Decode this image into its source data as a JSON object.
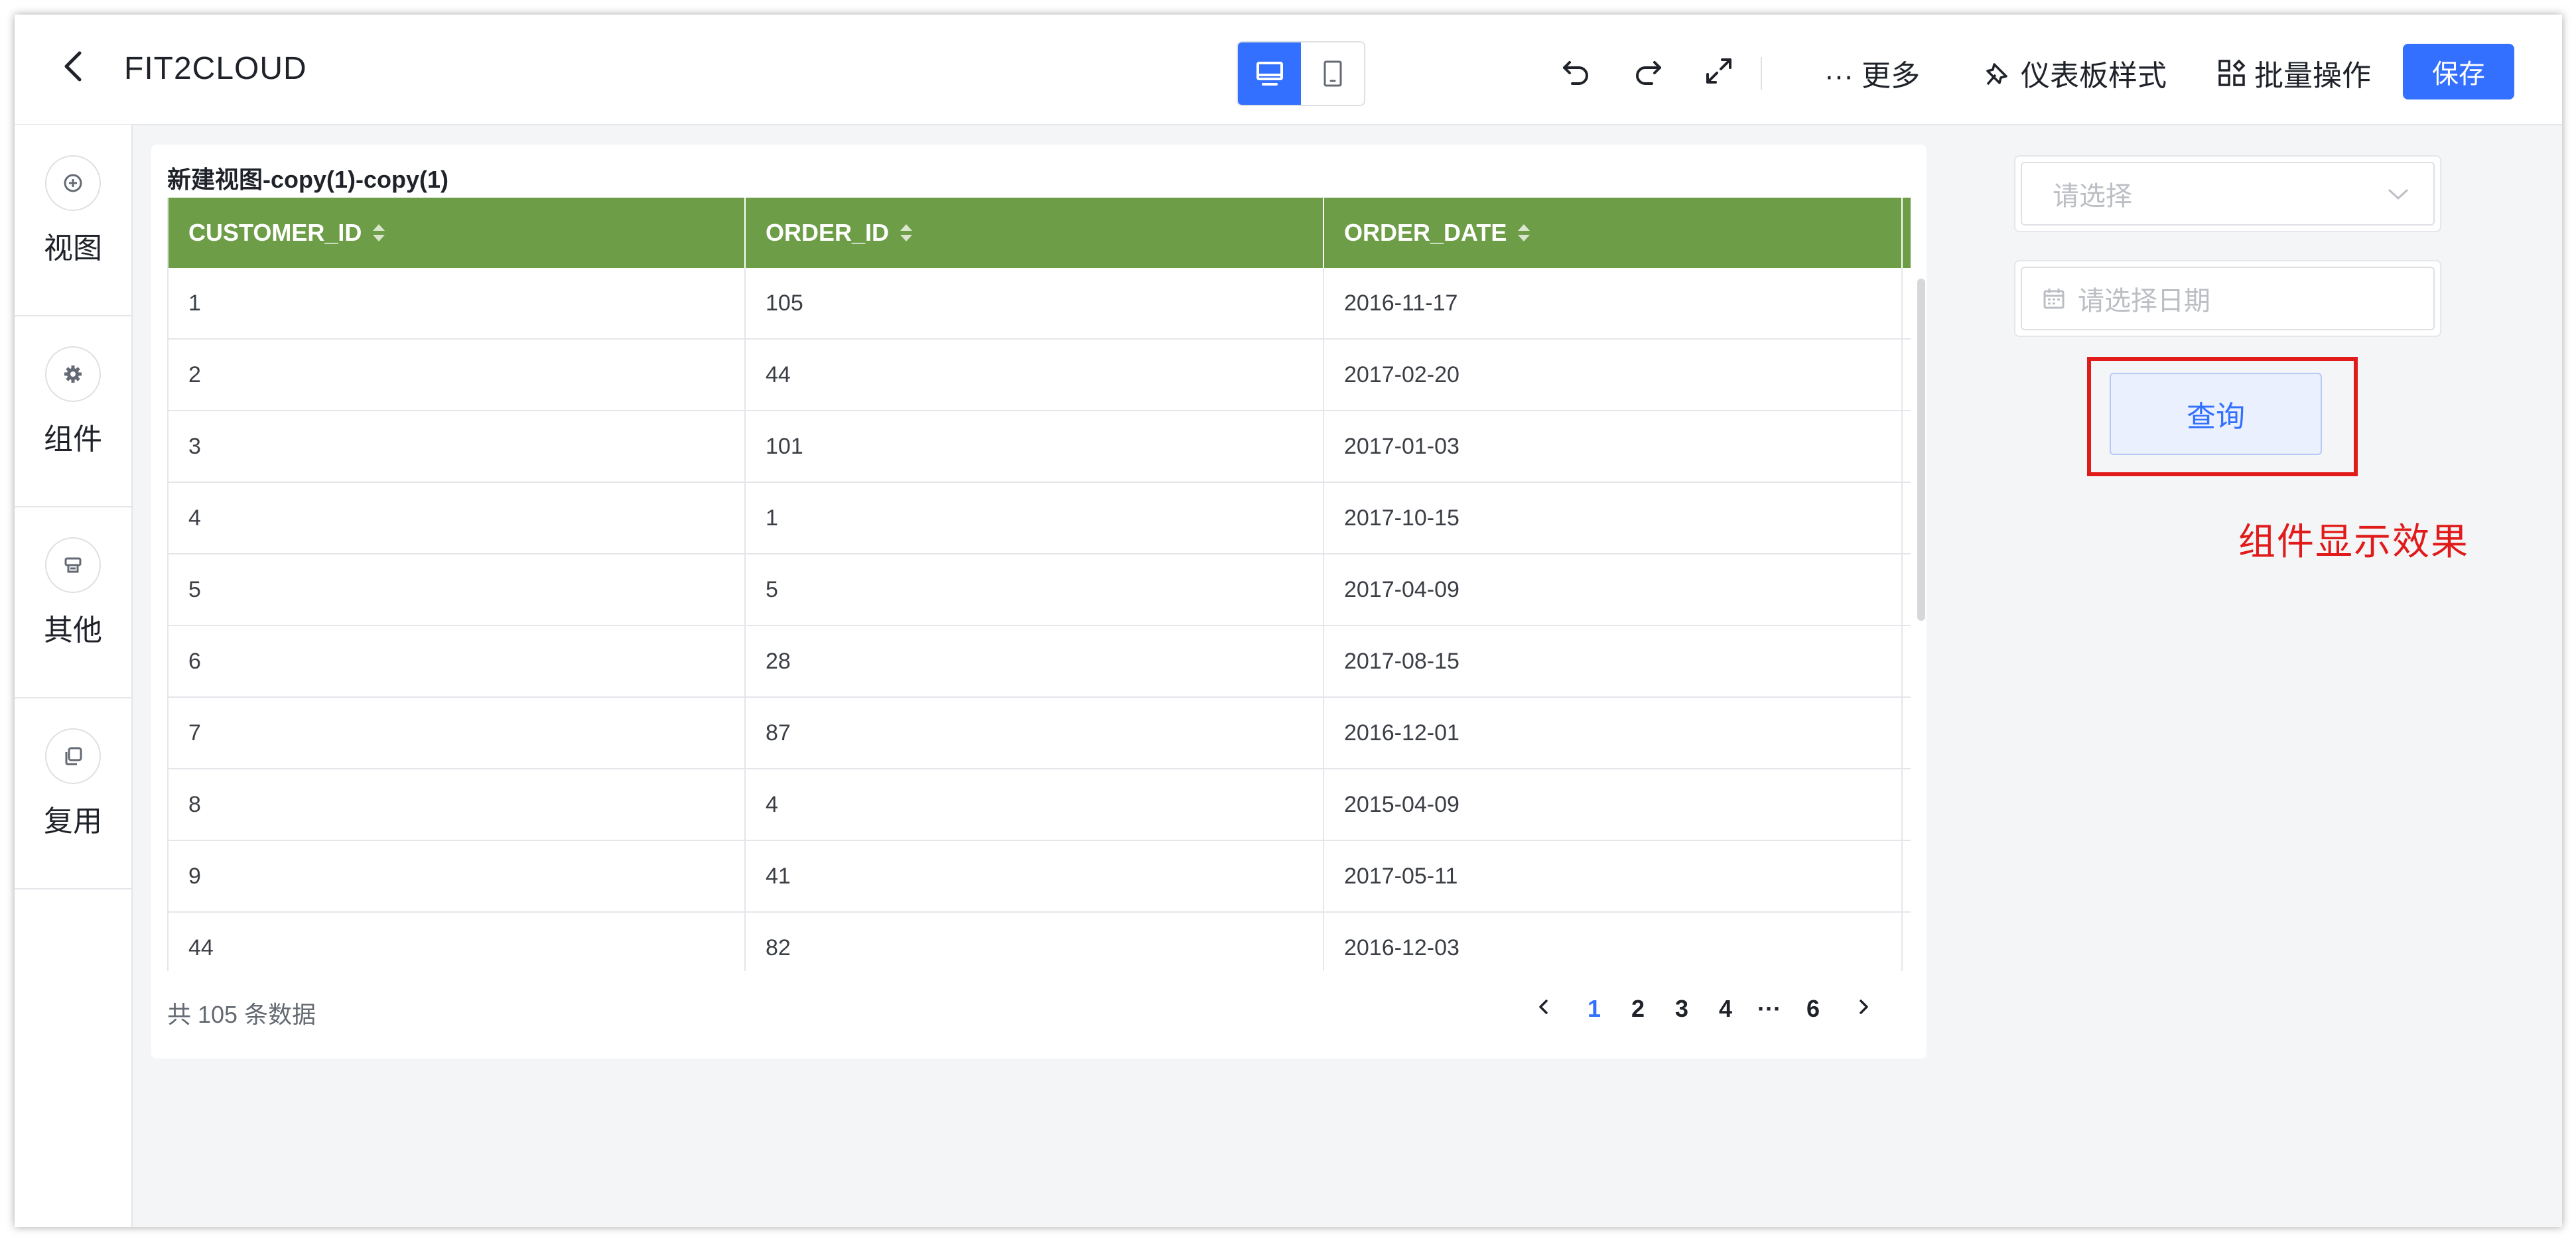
{
  "header": {
    "title": "FIT2CLOUD",
    "more_label": "··· 更多",
    "dashboard_style_label": "仪表板样式",
    "batch_label": "批量操作",
    "save_label": "保存"
  },
  "sidebar": {
    "items": [
      {
        "label": "视图",
        "icon": "plus-circle-icon"
      },
      {
        "label": "组件",
        "icon": "gear-icon"
      },
      {
        "label": "其他",
        "icon": "stamp-icon"
      },
      {
        "label": "复用",
        "icon": "copy-icon"
      }
    ]
  },
  "table": {
    "title": "新建视图-copy(1)-copy(1)",
    "header_color": "#6e9d48",
    "columns": [
      "CUSTOMER_ID",
      "ORDER_ID",
      "ORDER_DATE"
    ],
    "rows": [
      [
        "1",
        "105",
        "2016-11-17"
      ],
      [
        "2",
        "44",
        "2017-02-20"
      ],
      [
        "3",
        "101",
        "2017-01-03"
      ],
      [
        "4",
        "1",
        "2017-10-15"
      ],
      [
        "5",
        "5",
        "2017-04-09"
      ],
      [
        "6",
        "28",
        "2017-08-15"
      ],
      [
        "7",
        "87",
        "2016-12-01"
      ],
      [
        "8",
        "4",
        "2015-04-09"
      ],
      [
        "9",
        "41",
        "2017-05-11"
      ],
      [
        "44",
        "82",
        "2016-12-03"
      ]
    ],
    "total_text": "共 105 条数据",
    "pagination": {
      "pages": [
        "1",
        "2",
        "3",
        "4",
        "···",
        "6"
      ],
      "current": "1"
    }
  },
  "filters": {
    "select_placeholder": "请选择",
    "date_placeholder": "请选择日期",
    "query_label": "查询"
  },
  "annotation": {
    "text": "组件显示效果",
    "color": "#e11a1a"
  },
  "colors": {
    "accent": "#3370ff"
  }
}
